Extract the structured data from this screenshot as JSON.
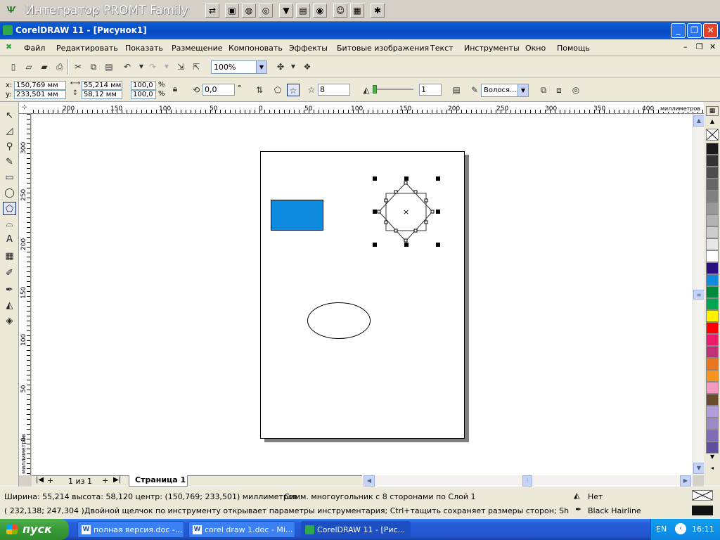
{
  "promt": {
    "title": "Интегратор PROMT Family"
  },
  "window": {
    "title": "CorelDRAW 11 - [Рисунок1]"
  },
  "menu": [
    "Файл",
    "Редактировать",
    "Показать",
    "Размещение",
    "Компоновать",
    "Эффекты",
    "Битовые изображения",
    "Текст",
    "Инструменты",
    "Окно",
    "Помощь"
  ],
  "toolbar": {
    "zoom": "100%"
  },
  "props": {
    "x_label": "x:",
    "x": "150,769 мм",
    "y_label": "y:",
    "y": "233,501 мм",
    "w": "55,214 мм",
    "h": "58,12 мм",
    "scale_x": "100,0",
    "scale_y": "100,0",
    "pct": "%",
    "angle": "0,0",
    "deg": "°",
    "sides": "8",
    "sharpness": "1",
    "outline": "Волося..."
  },
  "ruler": {
    "h_ticks": [
      "200",
      "150",
      "100",
      "50",
      "0",
      "50",
      "100",
      "150",
      "200",
      "250",
      "300",
      "350",
      "400"
    ],
    "units": "миллиметров",
    "v_ticks": [
      "300",
      "250",
      "200",
      "150",
      "100",
      "50",
      "0"
    ],
    "v_units": "миллиметров"
  },
  "pages": {
    "count": "1 из 1",
    "tab": "Страница 1"
  },
  "status": {
    "size": "Ширина: 55,214  высота: 58,120  центр: (150,769; 233,501)  миллиметров",
    "object": "Симм. многоугольник с 8 сторонами по Слой 1",
    "fill": "Нет",
    "coords": "( 232,138; 247,304 )",
    "hint": "Двойной щелчок по инструменту открывает параметры инструментария; Ctrl+тащить сохраняет размеры сторон; Shift+тащить рисует...",
    "outline": "Black  Hairline"
  },
  "taskbar": {
    "start": "пуск",
    "tasks": [
      "полная версия.doc -...",
      "corel draw 1.doc - Mi...",
      "CorelDRAW 11 - [Рис..."
    ],
    "lang": "EN",
    "time": "16:11"
  },
  "colors": {
    "rect_fill": "#0f8ce0",
    "accent": "#0a5fd8"
  },
  "palette": [
    "#1a1a1a",
    "#333333",
    "#4d4d4d",
    "#666666",
    "#808080",
    "#999999",
    "#b3b3b3",
    "#cccccc",
    "#e6e6e6",
    "#ffffff",
    "#2b0f80",
    "#0f8ce0",
    "#008a3e",
    "#00a651",
    "#fff200",
    "#ff0000",
    "#ed1c6b",
    "#c0317a",
    "#e87722",
    "#f7941d",
    "#f49ac1",
    "#6b4c2c",
    "#b39ddb",
    "#9c8ac7",
    "#7e6db5",
    "#5f4fa0"
  ]
}
